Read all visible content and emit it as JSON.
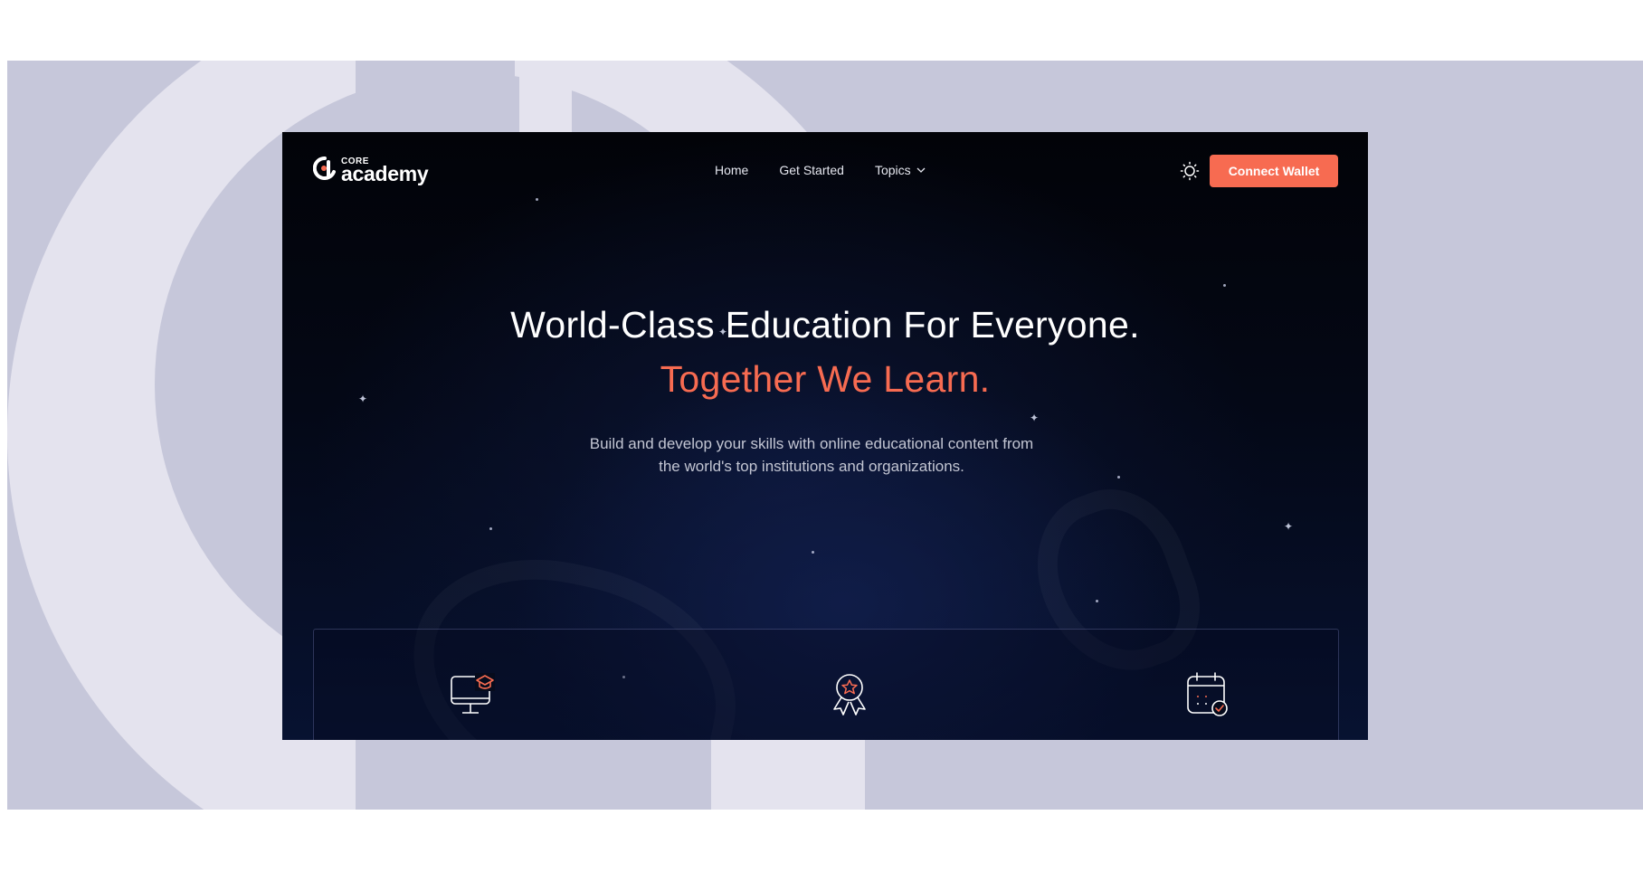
{
  "brand": {
    "small": "CORE",
    "big": "academy",
    "accent": "#f76b51"
  },
  "nav": {
    "links": [
      {
        "label": "Home"
      },
      {
        "label": "Get Started"
      },
      {
        "label": "Topics"
      }
    ],
    "connect_label": "Connect Wallet",
    "theme_icon": "sun-icon"
  },
  "hero": {
    "line1": "World-Class Education For Everyone.",
    "line2": "Together We Learn.",
    "subtitle_line1": "Build and develop your skills with online educational content from",
    "subtitle_line2": "the world's top institutions and organizations."
  },
  "features": {
    "icons": [
      "monitor-graduation-icon",
      "award-badge-icon",
      "calendar-check-icon"
    ]
  },
  "colors": {
    "backdrop": "#c6c7da",
    "backdrop_light": "#e4e3ee",
    "screen_bg": "#040816",
    "text_muted": "#c3c6d3"
  }
}
